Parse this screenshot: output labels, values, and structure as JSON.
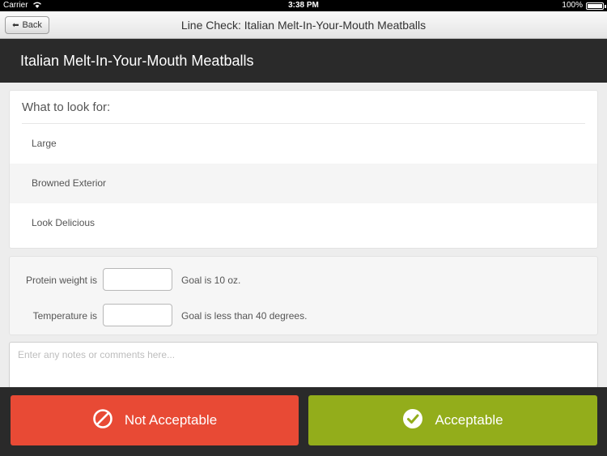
{
  "status": {
    "carrier": "Carrier",
    "time": "3:38 PM",
    "battery": "100%"
  },
  "nav": {
    "back_label": "Back",
    "title": "Line Check: Italian Melt-In-Your-Mouth Meatballs"
  },
  "header": {
    "title": "Italian Melt-In-Your-Mouth Meatballs"
  },
  "look_for": {
    "heading": "What to look for:",
    "items": [
      "Large",
      "Browned Exterior",
      "Look Delicious"
    ]
  },
  "measurements": {
    "protein": {
      "label": "Protein weight is",
      "value": "",
      "goal": "Goal is 10 oz."
    },
    "temperature": {
      "label": "Temperature is",
      "value": "",
      "goal": "Goal is less than 40 degrees."
    }
  },
  "notes": {
    "placeholder": "Enter any notes or comments here...",
    "value": ""
  },
  "actions": {
    "not_acceptable": "Not Acceptable",
    "acceptable": "Acceptable"
  },
  "colors": {
    "not_acceptable": "#e84a35",
    "acceptable": "#93ad1b",
    "header": "#2a2a2a"
  }
}
